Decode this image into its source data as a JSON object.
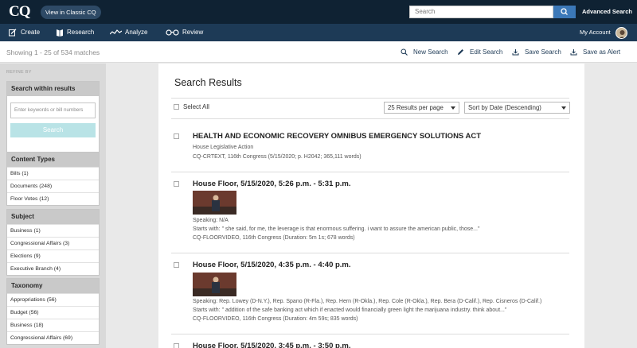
{
  "header": {
    "logo": "CQ",
    "classic_label": "View in Classic CQ",
    "search_placeholder": "Search",
    "advanced_label": "Advanced Search"
  },
  "nav": {
    "items": [
      {
        "label": "Create",
        "icon": "edit-icon"
      },
      {
        "label": "Research",
        "icon": "book-icon"
      },
      {
        "label": "Analyze",
        "icon": "trend-icon"
      },
      {
        "label": "Review",
        "icon": "glasses-icon"
      }
    ],
    "account_label": "My Account"
  },
  "subbar": {
    "showing": "Showing 1 - 25 of 534 matches",
    "actions": [
      {
        "label": "New Search",
        "icon": "search-icon"
      },
      {
        "label": "Edit Search",
        "icon": "pencil-icon"
      },
      {
        "label": "Save Search",
        "icon": "save-icon"
      },
      {
        "label": "Save as Alert",
        "icon": "alert-icon"
      }
    ]
  },
  "sidebar": {
    "refine_label": "REFINE BY",
    "search_within": {
      "title": "Search within results",
      "placeholder": "Enter keywords or bill numbers",
      "button": "Search"
    },
    "content_types": {
      "title": "Content Types",
      "items": [
        "Bills (1)",
        "Documents (248)",
        "Floor Votes (12)"
      ]
    },
    "subject": {
      "title": "Subject",
      "items": [
        "Business (1)",
        "Congressional Affairs (3)",
        "Elections (9)",
        "Executive Branch (4)"
      ]
    },
    "taxonomy": {
      "title": "Taxonomy",
      "items": [
        "Appropriations (56)",
        "Budget (56)",
        "Business (18)",
        "Congressional Affairs (69)"
      ]
    }
  },
  "main": {
    "title": "Search Results",
    "select_all": "Select All",
    "per_page": "25 Results per page",
    "sort": "Sort by Date (Descending)",
    "results": [
      {
        "title": "HEALTH AND ECONOMIC RECOVERY OMNIBUS EMERGENCY SOLUTIONS ACT",
        "lines": [
          "House Legislative Action",
          "CQ-CRTEXT, 116th Congress (5/15/2020; p. H2042; 365,111 words)"
        ]
      },
      {
        "title": "House Floor, 5/15/2020, 5:26 p.m. - 5:31 p.m.",
        "lines": [
          "Speaking: N/A",
          "Starts with: \" she said, for me, the leverage is that enormous suffering. i want to assure the american public, those...\"",
          "CQ-FLOORVIDEO, 116th Congress (Duration: 5m 1s; 678 words)"
        ]
      },
      {
        "title": "House Floor, 5/15/2020, 4:35 p.m. - 4:40 p.m.",
        "lines": [
          "Speaking: Rep. Lowey (D-N.Y.), Rep. Spano (R-Fla.), Rep. Hern (R-Okla.), Rep. Cole (R-Okla.), Rep. Bera (D-Calif.), Rep. Cisneros (D-Calif.)",
          "Starts with: \" addition of the safe banking act which if enacted would financially green light the marijuana industry. think about...\"",
          "CQ-FLOORVIDEO, 116th Congress (Duration: 4m 59s; 835 words)"
        ]
      },
      {
        "title": "House Floor, 5/15/2020, 3:45 p.m. - 3:50 p.m.",
        "lines": []
      }
    ]
  }
}
